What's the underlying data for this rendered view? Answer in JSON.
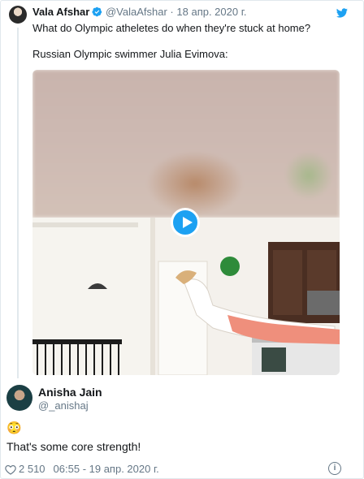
{
  "quoted": {
    "author_name": "Vala Afshar",
    "handle": "@ValaAfshar",
    "separator": "·",
    "date": "18 апр. 2020 г.",
    "text_line1": "What do Olympic atheletes do when they're stuck at home?",
    "text_line2": "Russian Olympic swimmer Julia Evimova:",
    "verified_icon": "verified-badge-icon",
    "brand_icon": "twitter-bird-icon",
    "brand_color": "#1da1f2"
  },
  "reply": {
    "author_name": "Anisha Jain",
    "handle": "@_anishaj",
    "emoji": "😳",
    "text": "That's some core strength!"
  },
  "footer": {
    "likes": "2 510",
    "timestamp": "06:55 - 19 апр. 2020 г.",
    "info_glyph": "i"
  }
}
